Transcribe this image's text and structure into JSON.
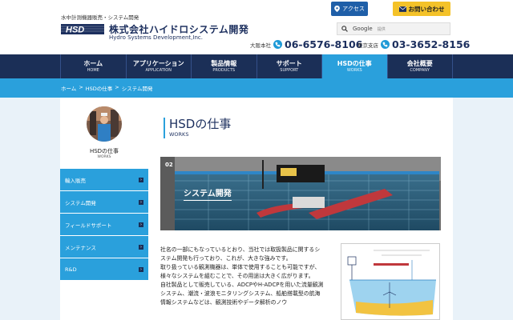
{
  "header": {
    "tagline": "水中計測機器販売・システム開発",
    "logo_text": "HSD",
    "company_name": "株式会社ハイドロシステム開発",
    "company_en": "Hydro Systems Development,Inc.",
    "access_label": "アクセス",
    "contact_label": "お問い合わせ",
    "search_brand": "Google",
    "search_placeholder": "提供",
    "phones": [
      {
        "label": "大阪本社",
        "number": "06-6576-8106"
      },
      {
        "label": "東京支店",
        "number": "03-3652-8156"
      }
    ]
  },
  "nav": [
    {
      "jp": "ホーム",
      "en": "HOME"
    },
    {
      "jp": "アプリケーション",
      "en": "APPLICATION"
    },
    {
      "jp": "製品情報",
      "en": "PRODUCTS"
    },
    {
      "jp": "サポート",
      "en": "SUPPORT"
    },
    {
      "jp": "HSDの仕事",
      "en": "WORKS"
    },
    {
      "jp": "会社概要",
      "en": "COMPANY"
    }
  ],
  "breadcrumb": [
    "ホーム",
    ">",
    "HSDの仕事",
    ">",
    "システム開発"
  ],
  "sidebar": {
    "title": "HSDの仕事",
    "title_en": "WORKS",
    "items": [
      {
        "label": "輸入販売"
      },
      {
        "label": "システム開発"
      },
      {
        "label": "フィールドサポート"
      },
      {
        "label": "メンテナンス"
      },
      {
        "label": "R&D"
      }
    ]
  },
  "main": {
    "title": "HSDの仕事",
    "title_en": "WORKS",
    "hero_number": "02",
    "hero_title": "システム開発",
    "paragraphs": [
      "社名の一部にもなっているとおり、当社では取扱製品に関するシステム開発も行っており、これが、大きな強みです。",
      "取り扱っている観測機器は、単体で使用することも可能ですが、様々なシステムを組むことで、その用途は大きく広がります。",
      "自社製品として販売している、ADCPやH-ADCPを用いた流量観測システム、潮流・波浪モニタリングシステム、船舶搭載型の航海情報システムなどは、観測技術やデータ解析のノウ"
    ]
  },
  "colors": {
    "navy": "#1b2f57",
    "accent_blue": "#2aa0dc",
    "contact_yellow": "#f4c229"
  },
  "icons": {
    "access": "map-pin-icon",
    "contact": "envelope-icon",
    "search": "search-icon",
    "phone": "phone-icon",
    "arrow": "chevron-right-icon"
  }
}
